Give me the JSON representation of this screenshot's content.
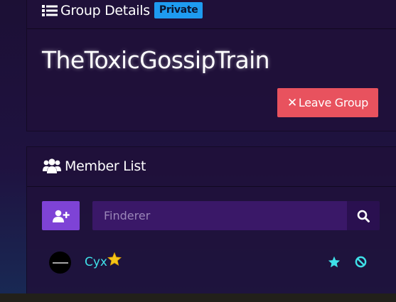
{
  "group_panel": {
    "header_icon": "list-icon",
    "header_title": "Group Details",
    "privacy_badge": "Private",
    "group_name": "TheToxicGossipTrain",
    "leave_button": {
      "icon": "x-icon",
      "label": "Leave Group"
    }
  },
  "member_panel": {
    "header_icon": "users-icon",
    "header_title": "Member List",
    "add_member_icon": "user-plus-icon",
    "search": {
      "placeholder": "Finderer",
      "value": "",
      "icon": "search-icon"
    },
    "members": [
      {
        "name": "Cyx",
        "role_icon": "star-icon",
        "actions": [
          "star-icon",
          "block-icon"
        ]
      }
    ]
  },
  "colors": {
    "badge": "#1e9bf0",
    "leave_button": "#e8525e",
    "add_button": "#7e43d6",
    "search_field": "#3a1868",
    "member_name": "#3fe0e8",
    "owner_star": "#f5c518",
    "action_icons": "#3fe0e8"
  }
}
